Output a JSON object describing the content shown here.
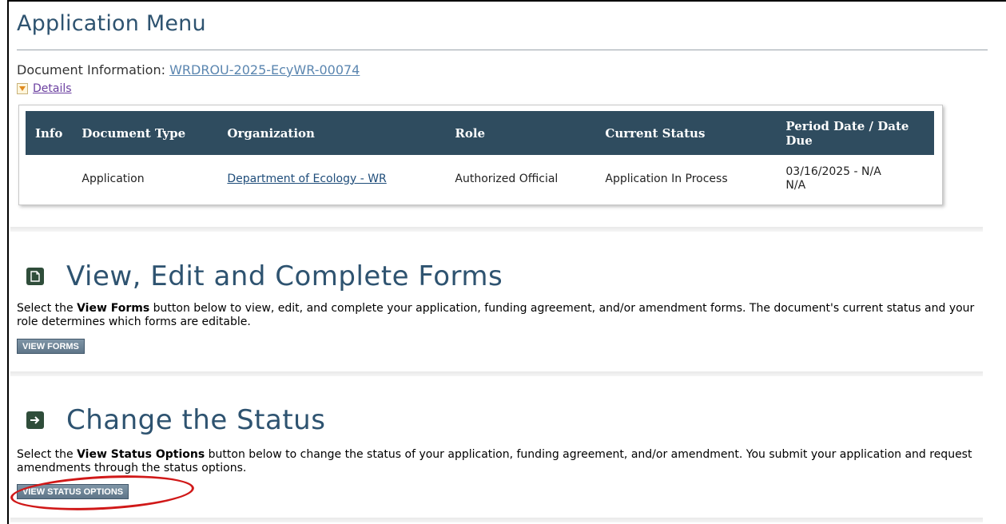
{
  "page": {
    "title": "Application Menu",
    "doc_info_label": "Document Information:",
    "doc_id": "WRDROU-2025-EcyWR-00074",
    "details_label": "Details"
  },
  "table": {
    "headers": [
      "Info",
      "Document Type",
      "Organization",
      "Role",
      "Current Status",
      "Period Date / Date Due"
    ],
    "row": {
      "info": "",
      "document_type": "Application",
      "organization": "Department of Ecology - WR",
      "role": "Authorized Official",
      "current_status": "Application In Process",
      "period_date": "03/16/2025 - N/A",
      "date_due": "N/A"
    }
  },
  "sections": {
    "forms": {
      "title": "View, Edit and Complete Forms",
      "desc_pre": "Select the ",
      "desc_bold": "View Forms",
      "desc_post": " button below to view, edit, and complete your application, funding agreement, and/or amendment forms. The document's current status and your role determines which forms are editable.",
      "button": "VIEW FORMS",
      "icon": "document-icon"
    },
    "status": {
      "title": "Change the Status",
      "desc_pre": "Select the ",
      "desc_bold": "View Status Options",
      "desc_post": " button below to change the status of your application, funding agreement, and/or amendment. You submit your application and request amendments through the status options.",
      "button": "VIEW STATUS OPTIONS",
      "icon": "arrow-right-icon"
    }
  },
  "colors": {
    "title": "#2e5370",
    "table_header": "#2f4c5f",
    "button": "#6b8193",
    "highlight": "#d01818"
  }
}
